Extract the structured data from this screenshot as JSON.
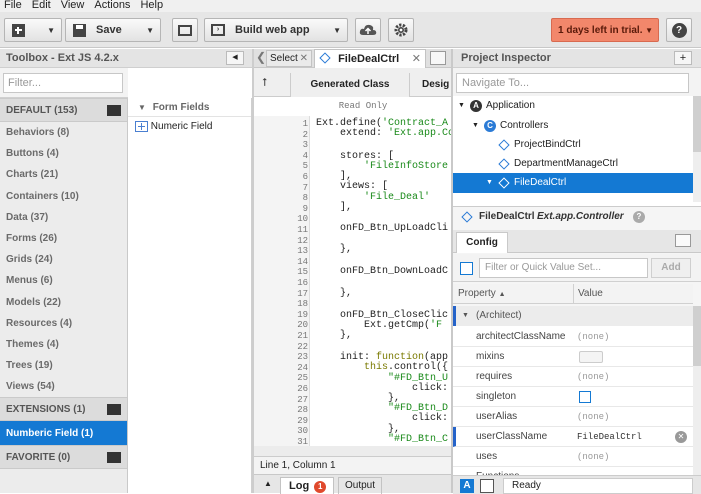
{
  "menubar": [
    "File",
    "Edit",
    "View",
    "Actions",
    "Help"
  ],
  "toolbar": {
    "save_label": "Save",
    "build_label": "Build web app",
    "trial_label": "1 days left in trial.",
    "help_label": "?"
  },
  "toolbox": {
    "title": "Toolbox - Ext JS 4.2.x",
    "filter_placeholder": "Filter...",
    "default_header": "DEFAULT (153)",
    "categories": [
      "Behaviors (8)",
      "Buttons (4)",
      "Charts (21)",
      "Containers (10)",
      "Data (37)",
      "Forms (26)",
      "Grids (24)",
      "Menus (6)",
      "Models (22)",
      "Resources (4)",
      "Themes (4)",
      "Trees (19)",
      "Views (54)"
    ],
    "extensions_header": "EXTENSIONS (1)",
    "selected_item": "Numberic Field (1)",
    "favorite_header": "FAVORITE (0)",
    "form_fields_header": "Form Fields",
    "form_fields": [
      "Numeric Field"
    ]
  },
  "editor": {
    "tab_select": "Select",
    "tab_active": "FileDealCtrl",
    "sub_generated": "Generated Class",
    "sub_design": "Desig",
    "read_only": "Read Only",
    "line_numbers": [
      "1",
      "2",
      "3",
      "4",
      "5",
      "6",
      "7",
      "8",
      "9",
      "10",
      "11",
      "12",
      "13",
      "14",
      "15",
      "16",
      "17",
      "18",
      "19",
      "20",
      "21",
      "22",
      "23",
      "24",
      "25",
      "26",
      "27",
      "28",
      "29",
      "30",
      "31"
    ],
    "status": "Line 1, Column 1",
    "log_label": "Log",
    "log_count": "1",
    "output_label": "Output"
  },
  "inspector": {
    "title": "Project Inspector",
    "add_label": "+",
    "navigate_placeholder": "Navigate To...",
    "tree": [
      "Application",
      "Controllers",
      "ProjectBindCtrl",
      "DepartmentManageCtrl",
      "FileDealCtrl"
    ],
    "selected_class": "FileDealCtrl",
    "selected_type": "Ext.app.Controller",
    "config_tab": "Config",
    "filter_placeholder": "Filter or Quick Value Set...",
    "add_button": "Add",
    "col_property": "Property",
    "col_value": "Value",
    "group": "(Architect)",
    "rows": [
      {
        "name": "architectClassName",
        "value": "(none)"
      },
      {
        "name": "mixins",
        "value": ""
      },
      {
        "name": "requires",
        "value": "(none)"
      },
      {
        "name": "singleton",
        "value": ""
      },
      {
        "name": "userAlias",
        "value": "(none)"
      },
      {
        "name": "userClassName",
        "value": "FileDealCtrl"
      },
      {
        "name": "uses",
        "value": "(none)"
      },
      {
        "name": "Functions",
        "value": ""
      }
    ],
    "ready": "Ready"
  },
  "colors": {
    "selection": "#1479d3",
    "trial": "#f2876b",
    "accent": "#2563c9"
  }
}
